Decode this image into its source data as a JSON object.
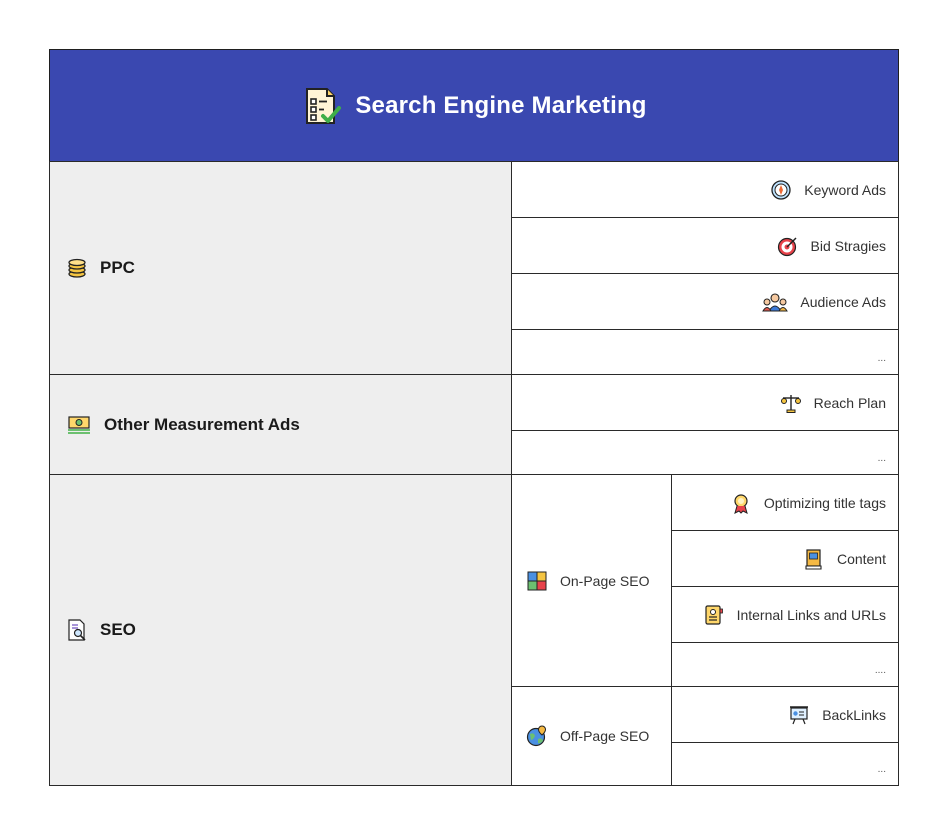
{
  "header": {
    "title": "Search Engine Marketing"
  },
  "ppc": {
    "label": "PPC",
    "items": [
      "Keyword Ads",
      "Bid Stragies",
      "Audience Ads",
      "..."
    ]
  },
  "other": {
    "label": "Other Measurement Ads",
    "items": [
      "Reach Plan",
      "..."
    ]
  },
  "seo": {
    "label": "SEO",
    "onpage": {
      "label": "On-Page SEO",
      "items": [
        "Optimizing title tags",
        "Content",
        "Internal Links and URLs",
        "...."
      ]
    },
    "offpage": {
      "label": "Off-Page SEO",
      "items": [
        "BackLinks",
        "..."
      ]
    }
  }
}
